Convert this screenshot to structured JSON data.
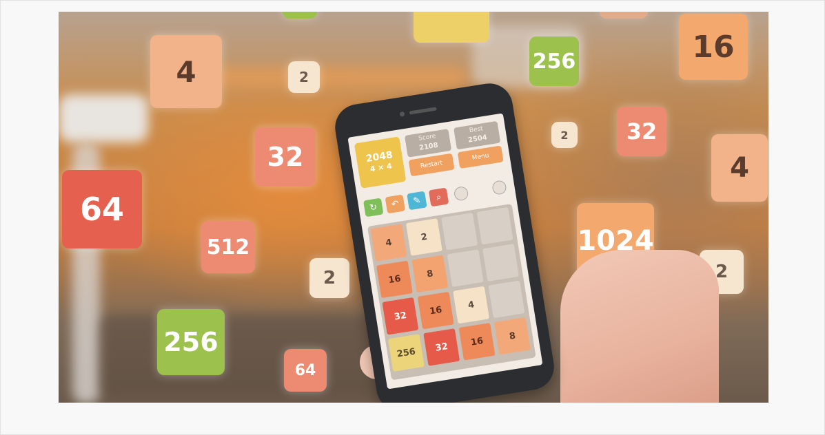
{
  "floating_tiles": [
    "4",
    "2",
    "32",
    "64",
    "512",
    "2",
    "256",
    "64",
    "256",
    "16",
    "2",
    "32",
    "4",
    "1024",
    "2"
  ],
  "phone": {
    "logo": {
      "title": "2048",
      "mode": "4 × 4"
    },
    "score_label": "Score",
    "score_value": "2108",
    "best_label": "Best",
    "best_value": "2504",
    "button_new": "Restart",
    "button_menu": "Menu",
    "board": [
      [
        "4",
        "2",
        "",
        ""
      ],
      [
        "16",
        "8",
        "",
        ""
      ],
      [
        "32",
        "16",
        "4",
        ""
      ],
      [
        "256",
        "32",
        "16",
        "8"
      ]
    ]
  },
  "colors": {
    "cream": "#f6e6cf",
    "peach": "#f2b28a",
    "salmon": "#ec8a72",
    "red": "#e5604e",
    "green": "#9cc14c",
    "yellow": "#eed069"
  }
}
